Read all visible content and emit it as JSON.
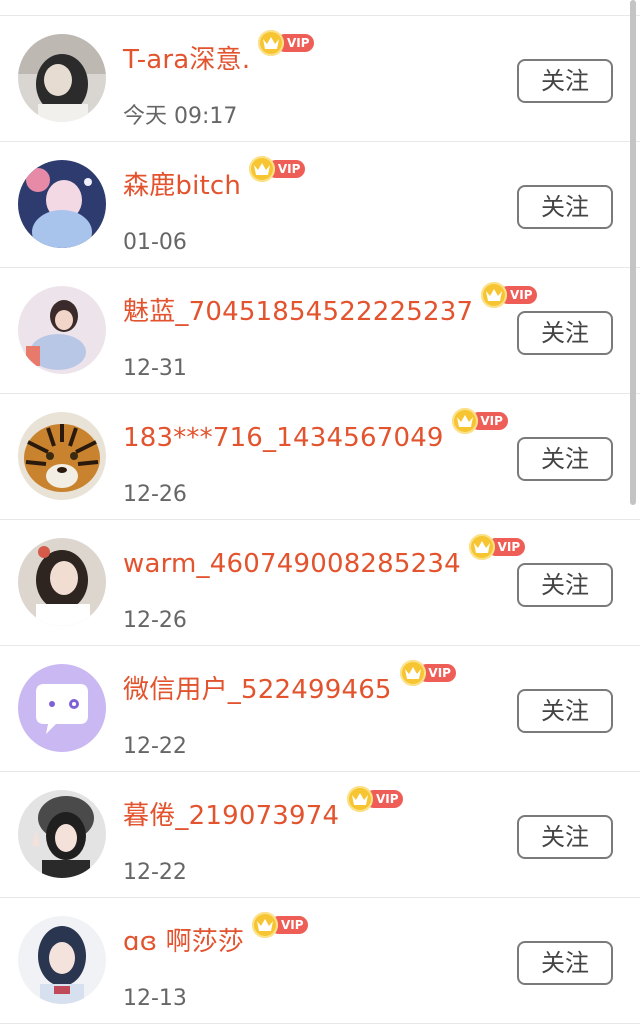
{
  "follow_label": "关注",
  "vip_label": "VIP",
  "users": [
    {
      "name": "T-ara深意.",
      "date": "今天 09:17",
      "avatar": "photo-user-1"
    },
    {
      "name": "森鹿bitch",
      "date": "01-06",
      "avatar": "photo-user-2"
    },
    {
      "name": "魅蓝_70451854522225237",
      "date": "12-31",
      "avatar": "photo-user-3"
    },
    {
      "name": "183***716_1434567049",
      "date": "12-26",
      "avatar": "tiger-photo"
    },
    {
      "name": "warm_460749008285234",
      "date": "12-26",
      "avatar": "photo-user-5"
    },
    {
      "name": "微信用户_522499465",
      "date": "12-22",
      "avatar": "default-chat-avatar"
    },
    {
      "name": "暮倦_219073974",
      "date": "12-22",
      "avatar": "photo-user-7"
    },
    {
      "name": "ɑɞ 啊莎莎",
      "date": "12-13",
      "avatar": "photo-user-8"
    }
  ],
  "colors": {
    "name": "#e2532e",
    "date": "#666666",
    "vip_pill": "#ef5d57",
    "crown": "#f7c531",
    "button_border": "#7a7a7a",
    "divider": "#e8e8e8"
  }
}
